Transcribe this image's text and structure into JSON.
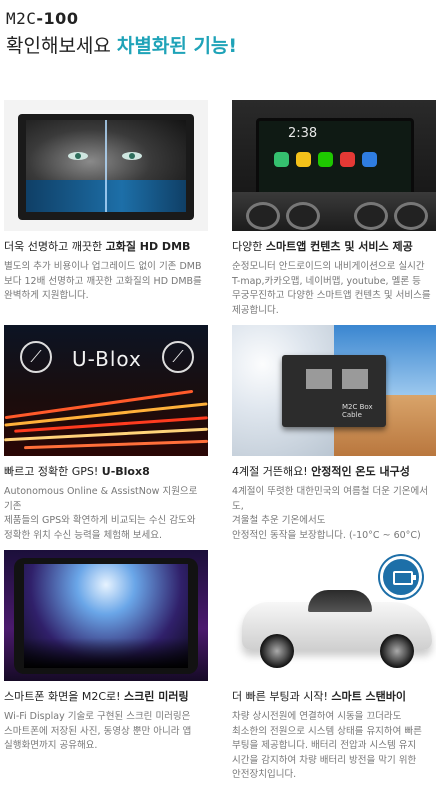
{
  "header": {
    "brand": "M2C",
    "model": "-100",
    "headline_prefix": "확인해보세요 ",
    "headline_accent": "차별화된 기능!"
  },
  "colors": {
    "accent": "#1fa3b8"
  },
  "cards": [
    {
      "title_prefix": "더욱 선명하고 깨끗한 ",
      "title_bold": "고화질 HD DMB",
      "desc": "별도의 추가 비용이나 업그레이드 없이 기존 DMB\n보다 12배 선명하고 깨끗한 고화질의 HD DMB를\n완벽하게 지원합니다."
    },
    {
      "title_prefix": "다양한 ",
      "title_bold": "스마트앱 컨텐츠 및 서비스 제공",
      "desc": "순정모니터 안드로이드의 내비게이션으로 실시간\nT-map,카카오맵, 네이버맵, youtube, 멜론 등\n무궁무진하고 다양한 스마트앱 컨텐츠 및 서비스를\n제공합니다.",
      "image": {
        "clock": "2:38"
      }
    },
    {
      "title_prefix": "빠르고 정확한 GPS! ",
      "title_bold": "U-Blox8",
      "desc": "Autonomous Online & AssistNow 지원으로 기존\n제품들의 GPS와 확연하게 비교되는 수신 감도와\n정확한 위치 수신 능력을 체험해 보세요.",
      "image": {
        "label": "U-Blox"
      }
    },
    {
      "title_prefix": "4계절 거뜬해요! ",
      "title_bold": "안정적인 온도 내구성",
      "desc": "4계절이 뚜렷한 대한민국의 여름철 더운 기온에서도,\n겨울철 추운 기온에서도\n안정적인 동작을 보장합니다. (-10°C ~ 60°C)",
      "image": {
        "brand": "M2C Box Cable"
      }
    },
    {
      "title_prefix": "스마트폰 화면을 M2C로! ",
      "title_bold": "스크린 미러링",
      "desc": "Wi-Fi Display 기술로 구현된 스크린 미러링은\n스마트폰에 저장된 사진, 동영상 뿐만 아니라 앱\n실행화면까지 공유해요."
    },
    {
      "title_prefix": "더 빠른 부팅과 시작! ",
      "title_bold": "스마트 스탠바이",
      "desc": "차량 상시전원에 연결하여 시동을 끄더라도\n최소한의 전원으로 시스템 상태를 유지하여 빠른\n부팅을 제공합니다. 배터리 전압과 시스템 유지\n시간을 감지하여 차량 배터리 방전을 막기 위한\n안전장치입니다."
    }
  ]
}
